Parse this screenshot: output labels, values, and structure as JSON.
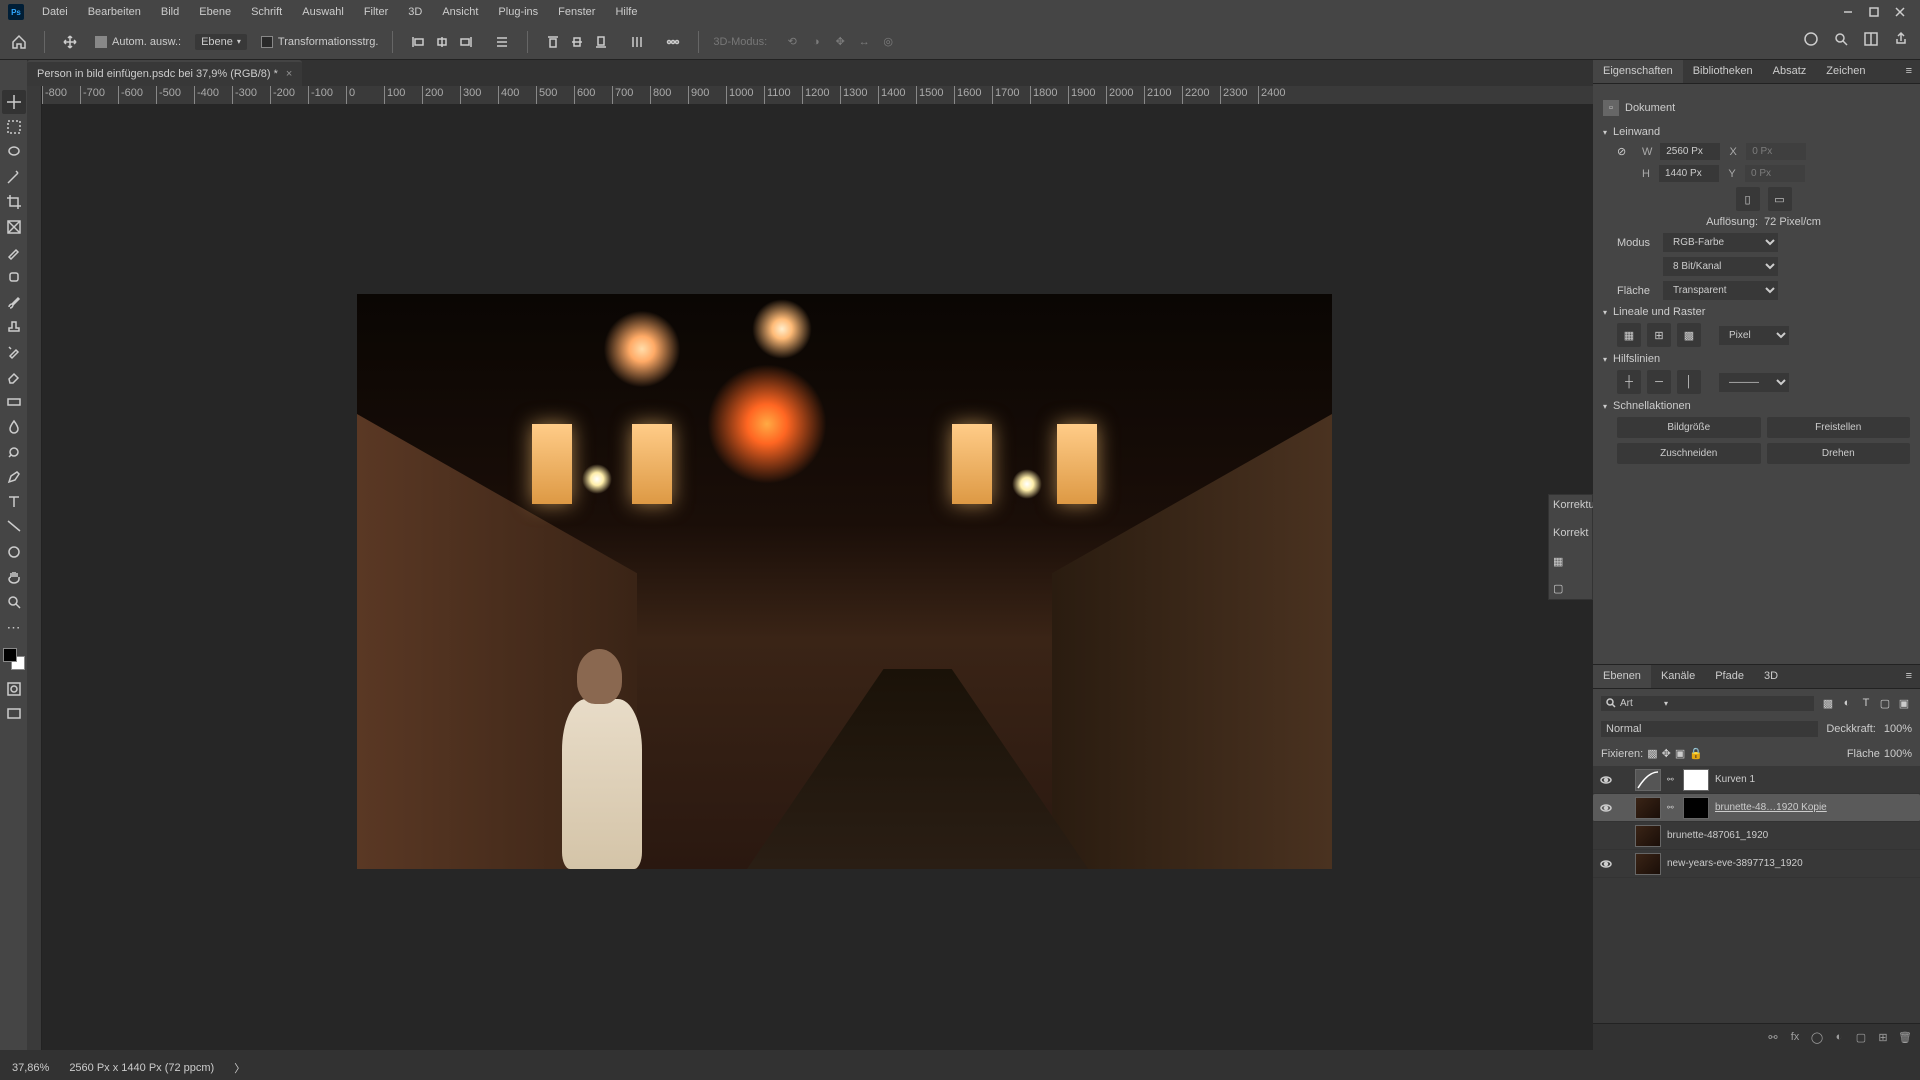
{
  "menu": {
    "items": [
      "Datei",
      "Bearbeiten",
      "Bild",
      "Ebene",
      "Schrift",
      "Auswahl",
      "Filter",
      "3D",
      "Ansicht",
      "Plug-ins",
      "Fenster",
      "Hilfe"
    ]
  },
  "options": {
    "autoSelect": "Autom. ausw.:",
    "layerSel": "Ebene",
    "transform": "Transformationsstrg.",
    "mode3d": "3D-Modus:"
  },
  "doc": {
    "title": "Person in bild einfügen.psdc bei 37,9% (RGB/8) *"
  },
  "ruler": [
    "-800",
    "-700",
    "-600",
    "-500",
    "-400",
    "-300",
    "-200",
    "-100",
    "0",
    "100",
    "200",
    "300",
    "400",
    "500",
    "600",
    "700",
    "800",
    "900",
    "1000",
    "1100",
    "1200",
    "1300",
    "1400",
    "1500",
    "1600",
    "1700",
    "1800",
    "1900",
    "2000",
    "2100",
    "2200",
    "2300",
    "2400"
  ],
  "status": {
    "zoom": "37,86%",
    "dims": "2560 Px x 1440 Px (72 ppcm)",
    "arrow": "〉"
  },
  "props": {
    "tabs": [
      "Eigenschaften",
      "Bibliotheken",
      "Absatz",
      "Zeichen"
    ],
    "docType": "Dokument",
    "canvas": {
      "title": "Leinwand",
      "w": "W",
      "wval": "2560 Px",
      "h": "H",
      "hval": "1440 Px",
      "x": "X",
      "xval": "0 Px",
      "y": "Y",
      "yval": "0 Px",
      "res": "Auflösung:",
      "resval": "72 Pixel/cm",
      "mode": "Modus",
      "modeval": "RGB-Farbe",
      "bits": "8 Bit/Kanal",
      "fill": "Fläche",
      "fillval": "Transparent"
    },
    "rulers": {
      "title": "Lineale und Raster",
      "unit": "Pixel"
    },
    "guides": {
      "title": "Hilfslinien"
    },
    "quick": {
      "title": "Schnellaktionen",
      "b1": "Bildgröße",
      "b2": "Freistellen",
      "b3": "Zuschneiden",
      "b4": "Drehen"
    }
  },
  "korr": {
    "t1": "Korrektu",
    "t2": "Korrekt"
  },
  "layers": {
    "tabs": [
      "Ebenen",
      "Kanäle",
      "Pfade",
      "3D"
    ],
    "filter": "Art",
    "blend": "Normal",
    "opacity": "Deckkraft:",
    "opval": "100%",
    "lock": "Fixieren:",
    "fill": "Fläche",
    "fillval": "100%",
    "items": [
      {
        "name": "Kurven 1",
        "type": "curves",
        "visible": true
      },
      {
        "name": "brunette-48…1920 Kopie",
        "type": "smart",
        "visible": true,
        "selected": true,
        "underline": true
      },
      {
        "name": "brunette-487061_1920",
        "type": "smart",
        "visible": false
      },
      {
        "name": "new-years-eve-3897713_1920",
        "type": "smart",
        "visible": true
      }
    ]
  }
}
